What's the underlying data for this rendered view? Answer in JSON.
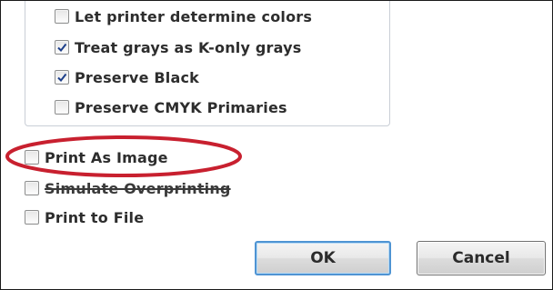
{
  "color_options": {
    "items": [
      {
        "label": "Let printer determine colors",
        "checked": false
      },
      {
        "label": "Treat grays as K-only grays",
        "checked": true
      },
      {
        "label": "Preserve Black",
        "checked": true
      },
      {
        "label": "Preserve CMYK Primaries",
        "checked": false
      }
    ]
  },
  "options": {
    "print_as_image": {
      "label": "Print As Image",
      "checked": false
    },
    "simulate_overprinting": {
      "label": "Simulate Overprinting",
      "checked": false
    },
    "print_to_file": {
      "label": "Print to File",
      "checked": false
    }
  },
  "buttons": {
    "ok_label": "OK",
    "cancel_label": "Cancel"
  },
  "colors": {
    "highlight_ellipse": "#c8202f",
    "default_button_border": "#4f94d3"
  }
}
